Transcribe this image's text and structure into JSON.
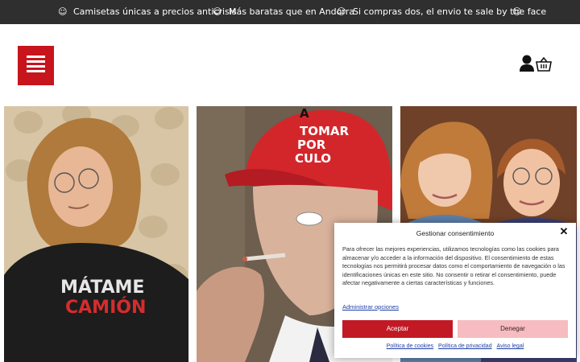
{
  "announcement": {
    "icon": "smiley-icon",
    "messages": [
      "Camisetas únicas a precios anticrisis",
      "Más baratas que en Andorra",
      "Si compras dos, el envio te sale by the face"
    ]
  },
  "header": {
    "menu_icon": "hamburger-icon",
    "account_icon": "user-icon",
    "cart_icon": "basket-icon"
  },
  "hero": {
    "panels": [
      {
        "shirt_line1": "MÁTAME",
        "shirt_line2": "CAMIÓN"
      },
      {
        "cap_line1": "A",
        "cap_line2": "TOMAR",
        "cap_line3": "POR",
        "cap_line4": "CULO"
      },
      {}
    ]
  },
  "consent": {
    "title": "Gestionar consentimiento",
    "body": "Para ofrecer las mejores experiencias, utilizamos tecnologías como las cookies para almacenar y/o acceder a la información del dispositivo. El consentimiento de estas tecnologías nos permitirá procesar datos como el comportamiento de navegación o las identificaciones únicas en este sitio. No consentir o retirar el consentimiento, puede afectar negativamente a ciertas características y funciones.",
    "manage_link": "Administrar opciones",
    "accept_label": "Aceptar",
    "deny_label": "Denegar",
    "footer_links": [
      "Política de cookies",
      "Política de privacidad",
      "Aviso legal"
    ]
  },
  "colors": {
    "brand_red": "#c8141c",
    "topbar_bg": "#2f2f2f",
    "deny_bg": "#f6bcc0",
    "link_blue": "#1e3ea8"
  }
}
